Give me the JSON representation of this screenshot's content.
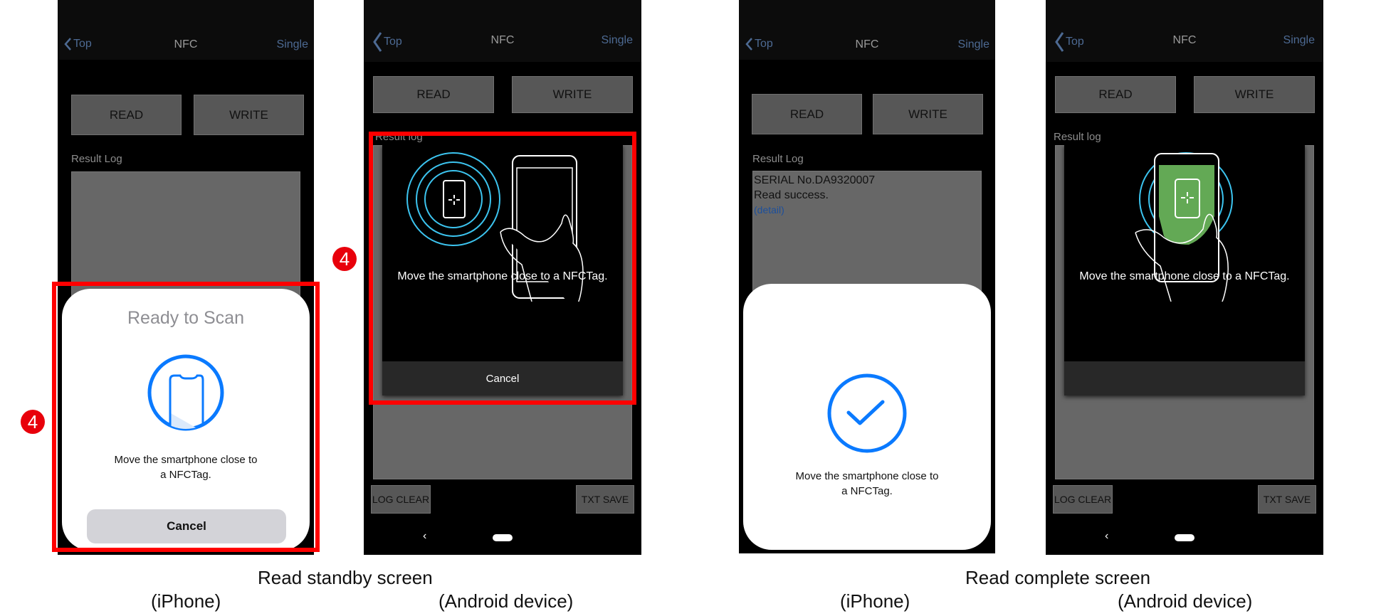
{
  "header": {
    "back_label": "Top",
    "title": "NFC",
    "right_label": "Single"
  },
  "buttons": {
    "read": "READ",
    "write": "WRITE",
    "log_clear": "LOG CLEAR",
    "txt_save": "TXT SAVE"
  },
  "labels": {
    "result_log_ios": "Result Log",
    "result_log_android": "Result log"
  },
  "badge_number": "4",
  "ios_standby": {
    "sheet_title": "Ready to Scan",
    "message_line1": "Move the smartphone close to",
    "message_line2": "a NFCTag.",
    "cancel": "Cancel"
  },
  "android_standby": {
    "message": "Move the smartphone close to a NFCTag.",
    "cancel": "Cancel"
  },
  "ios_complete": {
    "log_lines": [
      "SERIAL No.DA9320007",
      "Read success."
    ],
    "log_link": "(detail)",
    "message_line1": "Move the smartphone close to",
    "message_line2": "a NFCTag."
  },
  "android_complete": {
    "message": "Move the smartphone close to a NFCTag."
  },
  "captions": {
    "standby": "Read standby screen",
    "complete": "Read complete screen",
    "iphone": "(iPhone)",
    "android": "(Android device)"
  },
  "colors": {
    "accent_blue": "#0a7aff",
    "highlight_red": "#ff0000",
    "nfc_green": "#63a955",
    "nfc_ring": "#3cc4ef"
  }
}
